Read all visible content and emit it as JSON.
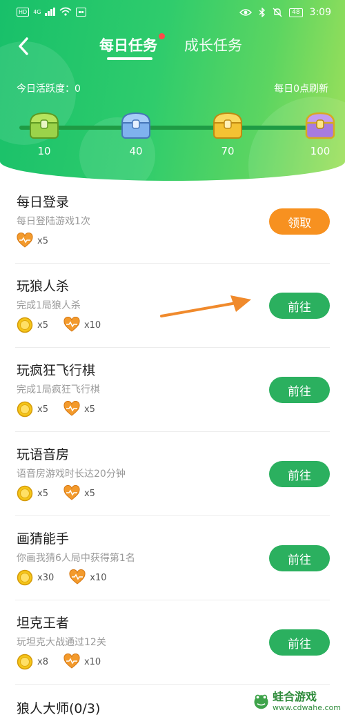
{
  "status_bar": {
    "network_left": "HD",
    "network_gen": "4G",
    "time": "3:09",
    "battery": "48"
  },
  "tabs": [
    {
      "label": "每日任务",
      "active": true,
      "has_dot": true
    },
    {
      "label": "成长任务",
      "active": false
    }
  ],
  "activity": {
    "label": "今日活跃度：0",
    "refresh_note": "每日0点刷新"
  },
  "chests": [
    {
      "value": "10",
      "color": "#9bd34a"
    },
    {
      "value": "40",
      "color": "#7fb2ee"
    },
    {
      "value": "70",
      "color": "#f4c233"
    },
    {
      "value": "100",
      "color": "#a77be0"
    }
  ],
  "tasks": [
    {
      "title": "每日登录",
      "desc": "每日登陆游戏1次",
      "coin": "",
      "heart": "x5",
      "button": "领取",
      "button_type": "orange"
    },
    {
      "title": "玩狼人杀",
      "desc": "完成1局狼人杀",
      "coin": "x5",
      "heart": "x10",
      "button": "前往",
      "button_type": "green"
    },
    {
      "title": "玩疯狂飞行棋",
      "desc": "完成1局疯狂飞行棋",
      "coin": "x5",
      "heart": "x5",
      "button": "前往",
      "button_type": "green"
    },
    {
      "title": "玩语音房",
      "desc": "语音房游戏时长达20分钟",
      "coin": "x5",
      "heart": "x5",
      "button": "前往",
      "button_type": "green"
    },
    {
      "title": "画猜能手",
      "desc": "你画我猜6人局中获得第1名",
      "coin": "x30",
      "heart": "x10",
      "button": "前往",
      "button_type": "green"
    },
    {
      "title": "坦克王者",
      "desc": "玩坦克大战通过12关",
      "coin": "x8",
      "heart": "x10",
      "button": "前往",
      "button_type": "green"
    },
    {
      "title": "狼人大师(0/3)",
      "desc": "",
      "coin": "",
      "heart": "",
      "button": "",
      "button_type": ""
    }
  ],
  "watermark": {
    "name": "蛙合游戏",
    "url": "www.cdwahe.com"
  },
  "colors": {
    "header_start": "#18c06a",
    "header_end": "#9fe05a",
    "button_green": "#2bb05f",
    "button_orange": "#f79120",
    "arrow": "#f08a2c"
  }
}
